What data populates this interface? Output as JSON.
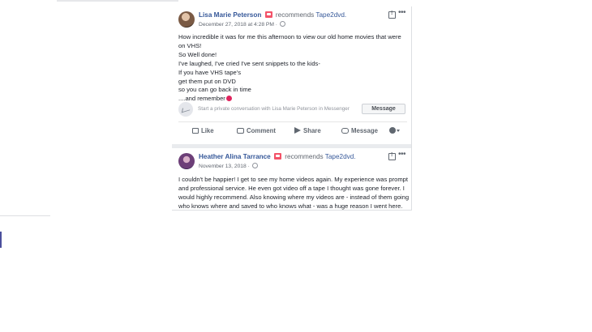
{
  "posts": [
    {
      "author": "Lisa Marie Peterson",
      "action": "recommends",
      "page": "Tape2dvd.",
      "date": "December 27, 2018 at 4:28 PM",
      "dot": "·",
      "lines": [
        "How incredible it was for me this afternoon to view our old home movies that were",
        "on VHS!",
        "So Well done!",
        "I've laughed, I've cried I've sent snippets to the kids-",
        "If you have VHS tape's",
        "get them put on DVD",
        "so you can go back in time",
        "....and remember"
      ],
      "messenger_prompt": "Start a private conversation with Lisa Marie Peterson in Messenger",
      "message_button": "Message",
      "actions": {
        "like": "Like",
        "comment": "Comment",
        "share": "Share",
        "message": "Message"
      }
    },
    {
      "author": "Heather Alina Tarrance",
      "action": "recommends",
      "page": "Tape2dvd.",
      "date": "November 13, 2018",
      "dot": "·",
      "lines": [
        "I couldn't be happier! I get to see my home videos again. My experience was prompt",
        "and professional service. He even got video off a tape I thought was gone forever. I",
        "would highly recommend. Also knowing where my videos are - instead of them going",
        "who knows where and saved to who knows what - was a huge reason I went here."
      ]
    }
  ],
  "icons": {
    "recommend": "recommend-badge-icon",
    "privacy": "globe-icon",
    "report": "flag-icon",
    "menu": "more-options-icon",
    "messenger": "messenger-icon",
    "like": "like-thumb-icon",
    "comment": "comment-bubble-icon",
    "share": "share-arrow-icon",
    "message": "message-bubble-icon",
    "audience": "audience-selector-icon",
    "emoji": "heart-emoji-icon"
  },
  "colors": {
    "link": "#365899",
    "recommend_badge": "#f35369",
    "heart": "#e0245e",
    "secondary_text": "#616770"
  }
}
